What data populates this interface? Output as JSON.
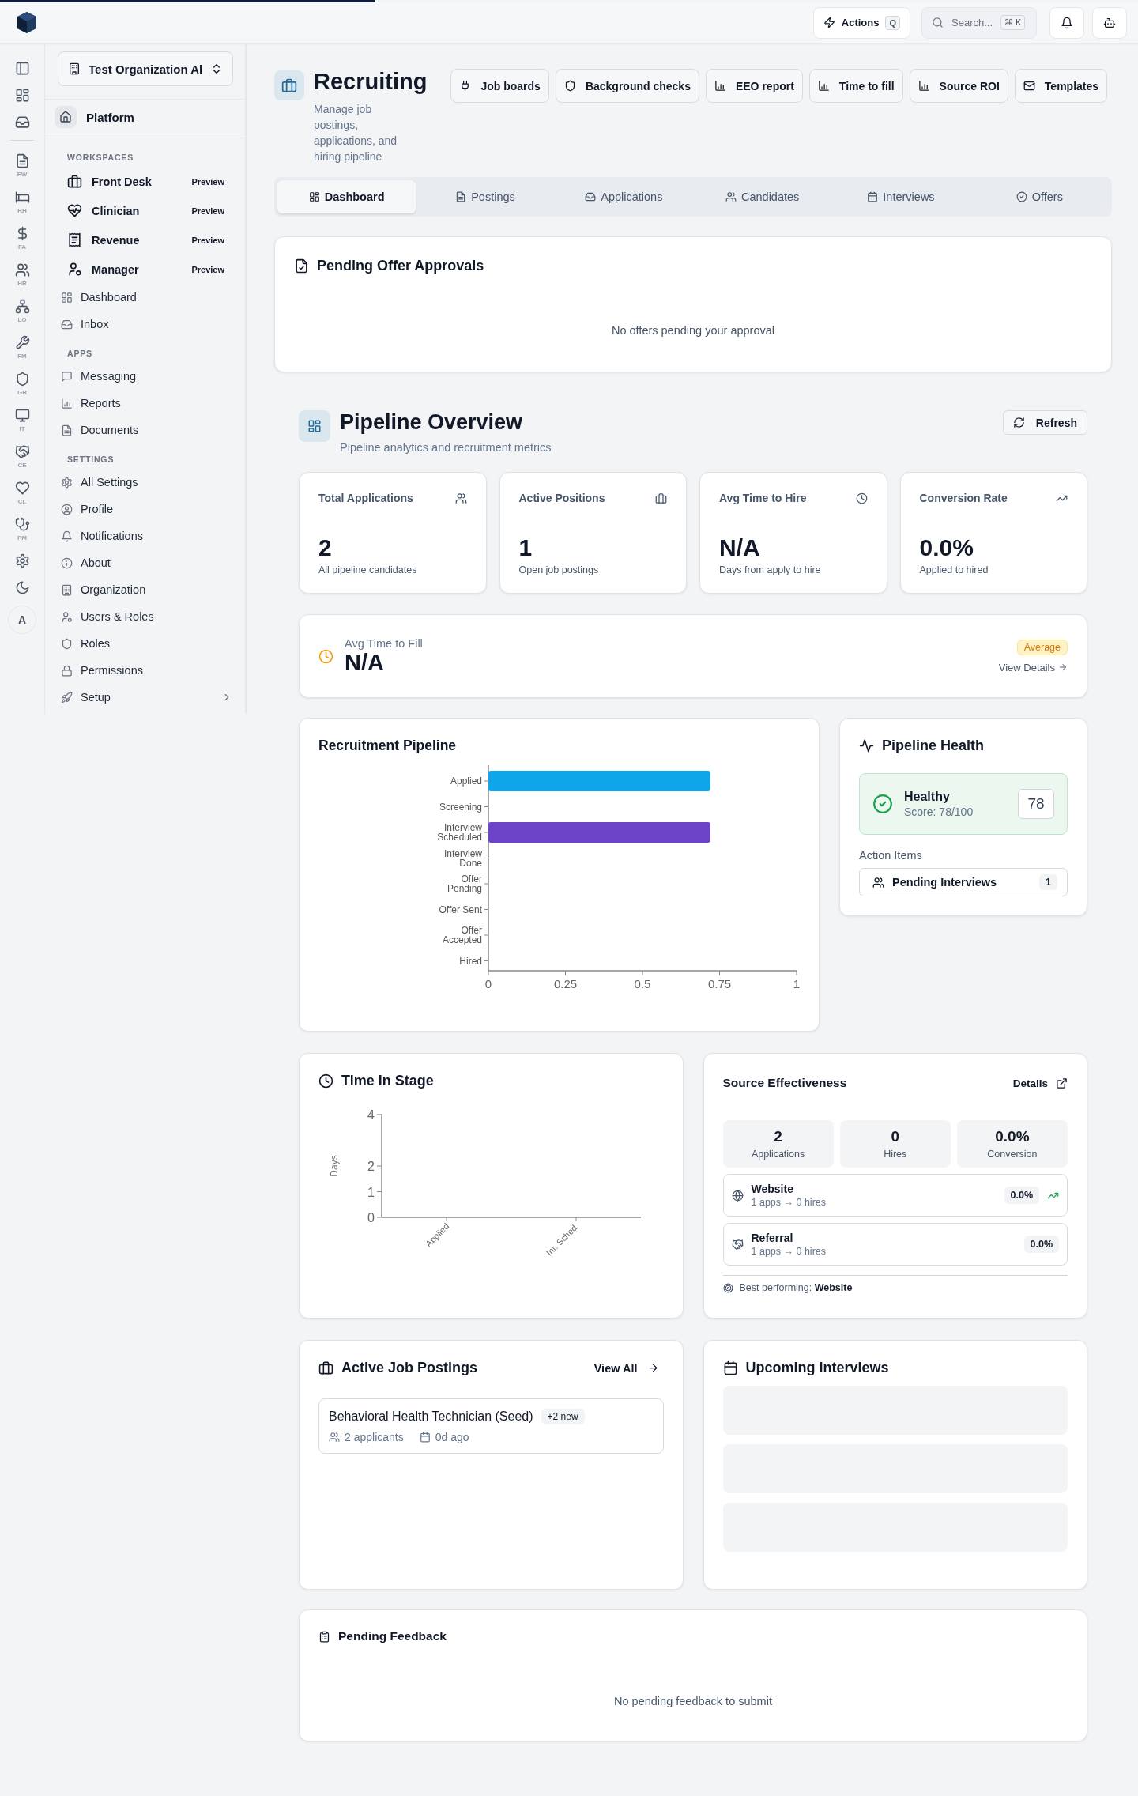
{
  "loading_bar": {
    "level": 0.33
  },
  "topbar": {
    "actions": {
      "label": "Actions",
      "shortcut": "Q"
    },
    "search": {
      "placeholder": "Search...",
      "shortcut": "⌘ K"
    }
  },
  "rail": {
    "labels": [
      "FW",
      "RH",
      "FA",
      "HR",
      "LO",
      "FM",
      "GR",
      "IT",
      "CE",
      "CL",
      "PM"
    ],
    "avatar": "A"
  },
  "sidebar": {
    "org": "Test Organization Al",
    "platform": "Platform",
    "sections": [
      {
        "kind": "workspace",
        "heading": "WORKSPACES",
        "items": [
          {
            "label": "Front Desk",
            "badge": "Preview"
          },
          {
            "label": "Clinician",
            "badge": "Preview"
          },
          {
            "label": "Revenue",
            "badge": "Preview"
          },
          {
            "label": "Manager",
            "badge": "Preview"
          }
        ]
      },
      {
        "kind": "plain",
        "items": [
          {
            "label": "Dashboard"
          },
          {
            "label": "Inbox"
          }
        ]
      },
      {
        "kind": "plain",
        "heading": "APPS",
        "items": [
          {
            "label": "Messaging"
          },
          {
            "label": "Reports"
          },
          {
            "label": "Documents"
          }
        ]
      },
      {
        "kind": "plain",
        "heading": "SETTINGS",
        "items": [
          {
            "label": "All Settings"
          },
          {
            "label": "Profile"
          },
          {
            "label": "Notifications"
          },
          {
            "label": "About"
          },
          {
            "label": "Organization"
          },
          {
            "label": "Users & Roles"
          },
          {
            "label": "Roles"
          },
          {
            "label": "Permissions"
          },
          {
            "label": "Setup",
            "has_children": true
          }
        ]
      }
    ]
  },
  "page": {
    "title": "Recruiting",
    "subtitle": "Manage job postings, applications, and hiring pipeline",
    "actions": [
      "Job boards",
      "Background checks",
      "EEO report",
      "Time to fill",
      "Source ROI",
      "Templates"
    ]
  },
  "tabs": [
    {
      "label": "Dashboard",
      "selected": true
    },
    {
      "label": "Postings",
      "selected": false
    },
    {
      "label": "Applications",
      "selected": false
    },
    {
      "label": "Candidates",
      "selected": false
    },
    {
      "label": "Interviews",
      "selected": false
    },
    {
      "label": "Offers",
      "selected": false
    }
  ],
  "offer_approvals": {
    "title": "Pending Offer Approvals",
    "empty": "No offers pending your approval"
  },
  "overview": {
    "title": "Pipeline Overview",
    "subtitle": "Pipeline analytics and recruitment metrics",
    "refresh": "Refresh",
    "metrics": [
      {
        "label": "Total Applications",
        "value": "2",
        "note": "All pipeline candidates"
      },
      {
        "label": "Active Positions",
        "value": "1",
        "note": "Open job postings"
      },
      {
        "label": "Avg Time to Hire",
        "value": "N/A",
        "note": "Days from apply to hire"
      },
      {
        "label": "Conversion Rate",
        "value": "0.0%",
        "note": "Applied to hired"
      }
    ],
    "time_to_fill": {
      "label": "Avg Time to Fill",
      "value": "N/A",
      "badge": "Average",
      "link": "View Details"
    },
    "pipeline": {
      "title": "Recruitment Pipeline",
      "chart_data": {
        "type": "bar",
        "orientation": "horizontal",
        "stacked": true,
        "categories": [
          "Applied",
          "Screening",
          "Interview Scheduled",
          "Interview Done",
          "Offer Pending",
          "Offer Sent",
          "Offer Accepted",
          "Hired"
        ],
        "series": [
          {
            "color": "#0ea5e9",
            "values": [
              0.72,
              0,
              0,
              0,
              0,
              0,
              0,
              0
            ]
          },
          {
            "color": "#6d44c8",
            "values": [
              0,
              0,
              0.72,
              0,
              0,
              0,
              0,
              0
            ]
          }
        ],
        "xlim": [
          0,
          1
        ],
        "xticks": [
          0,
          {
            "value": 0.25,
            "label": "0.25"
          },
          {
            "value": 0.5,
            "label": "0.5"
          },
          {
            "value": 0.75,
            "label": "0.75"
          },
          1
        ]
      }
    },
    "health": {
      "title": "Pipeline Health",
      "status": "Healthy",
      "score_text": "Score: 78/100",
      "score": "78",
      "action_heading": "Action Items",
      "actions": [
        {
          "label": "Pending Interviews",
          "count": "1"
        }
      ]
    },
    "time_in_stage": {
      "title": "Time in Stage",
      "chart_data": {
        "type": "bar",
        "categories": [
          "Applied",
          "Int. Sched."
        ],
        "series": [
          {
            "values": [
              0,
              0
            ]
          }
        ],
        "ylabel": "Days",
        "ylim": [
          0,
          4
        ],
        "yticks": [
          0,
          1,
          2,
          4
        ]
      }
    },
    "sources": {
      "title": "Source Effectiveness",
      "link": "Details",
      "stats": [
        {
          "value": "2",
          "label": "Applications"
        },
        {
          "value": "0",
          "label": "Hires"
        },
        {
          "value": "0.0%",
          "label": "Conversion"
        }
      ],
      "rows": [
        {
          "name": "Website",
          "detail": "1 apps → 0 hires",
          "rate": "0.0%",
          "trending": true
        },
        {
          "name": "Referral",
          "detail": "1 apps → 0 hires",
          "rate": "0.0%",
          "trending": false
        }
      ],
      "best": "Best performing: **Website**"
    },
    "postings": {
      "title": "Active Job Postings",
      "link": "View All",
      "items": [
        {
          "title": "Behavioral Health Technician (Seed)",
          "badge": "+2 new",
          "applicants": "2 applicants",
          "age": "0d ago"
        }
      ]
    },
    "interviews": {
      "title": "Upcoming Interviews",
      "loading": true
    },
    "feedback": {
      "title": "Pending Feedback",
      "empty": "No pending feedback to submit"
    }
  }
}
